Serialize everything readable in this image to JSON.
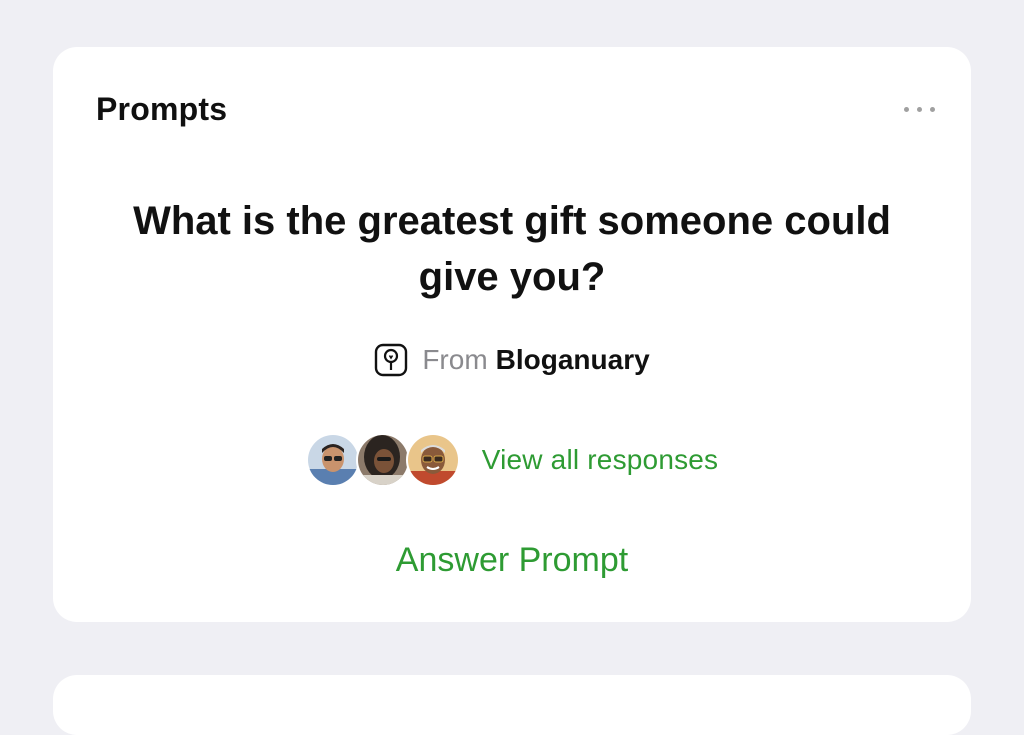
{
  "card": {
    "title": "Prompts",
    "menu_icon": "more-horizontal-icon"
  },
  "prompt": {
    "question": "What is the greatest gift someone could give you?",
    "source_prefix": "From",
    "source_name": "Bloganuary",
    "source_icon": "bloganuary-icon"
  },
  "responses": {
    "avatars": [
      "avatar-1",
      "avatar-2",
      "avatar-3"
    ],
    "link_label": "View all responses"
  },
  "actions": {
    "answer_label": "Answer Prompt"
  },
  "colors": {
    "accent": "#2e9b33",
    "background": "#efeff4",
    "card": "#ffffff",
    "muted": "#8a8a8e"
  }
}
